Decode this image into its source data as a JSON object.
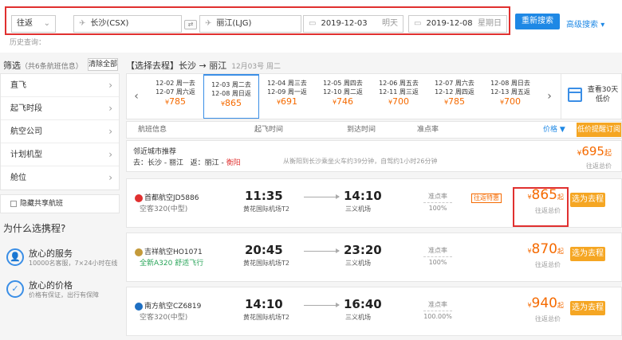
{
  "search": {
    "trip_type": "往返",
    "from_city": "长沙(CSX)",
    "to_city": "丽江(LJG)",
    "depart_date": "2019-12-03",
    "depart_weekday": "明天",
    "return_date": "2019-12-08",
    "return_weekday": "星期日",
    "swap_label": "⇄",
    "search_button": "重新搜索",
    "advanced_search": "高级搜索",
    "history_label": "历史查询："
  },
  "sidebar": {
    "filter_title": "筛选",
    "filter_count": "（共6条航班信息）",
    "clear_all": "清除全部",
    "items": [
      {
        "label": "直飞"
      },
      {
        "label": "起飞时段"
      },
      {
        "label": "航空公司"
      },
      {
        "label": "计划机型"
      },
      {
        "label": "舱位"
      }
    ],
    "shared_flights": "隐藏共享航班",
    "why_title": "为什么选携程?",
    "why_items": [
      {
        "title": "放心的服务",
        "desc": "10000名客服，7×24小时在线"
      },
      {
        "title": "放心的价格",
        "desc": "价格有保证，出行有保障"
      }
    ]
  },
  "main": {
    "route_title": "【选择去程】长沙 → 丽江",
    "route_date": "12月03号 周二",
    "dates": [
      {
        "go": "12-02 周一去",
        "back": "12-07 周六返",
        "price": "785"
      },
      {
        "go": "12-03 周二去",
        "back": "12-08 周日返",
        "price": "865"
      },
      {
        "go": "12-04 周三去",
        "back": "12-09 周一返",
        "price": "691"
      },
      {
        "go": "12-05 周四去",
        "back": "12-10 周二返",
        "price": "746"
      },
      {
        "go": "12-06 周五去",
        "back": "12-11 周三返",
        "price": "700"
      },
      {
        "go": "12-07 周六去",
        "back": "12-12 周四返",
        "price": "785"
      },
      {
        "go": "12-08 周日去",
        "back": "12-13 周五返",
        "price": "700"
      }
    ],
    "price_currency": "¥",
    "calendar_label": "查看30天低价",
    "columns": {
      "flight_info": "航班信息",
      "depart_time": "起飞时间",
      "arrive_time": "到达时间",
      "ontime_rate": "准点率",
      "price": "价格 ▼",
      "low_price_remind": "低价提醒订阅"
    },
    "nearby": {
      "title": "邻近城市推荐",
      "route_go": "去：长沙 - 丽江",
      "route_back_prefix": "返：丽江 - ",
      "route_back_city": "衡阳",
      "note": "从衡阳到长沙乘坐火车约39分钟，自驾约1小时26分钟",
      "price": "695",
      "price_suffix": "起",
      "price_label": "往返总价"
    },
    "flights": [
      {
        "airline": "首都航空JD5886",
        "plane_prefix": "空客320(中型)",
        "plane_green": "",
        "dep_time": "11:35",
        "dep_airport": "黄花国际机场T2",
        "arr_time": "14:10",
        "arr_airport": "三义机场",
        "ontime_label": "准点率",
        "ontime": "100%",
        "tag": "往返特惠",
        "price": "865",
        "price_suffix": "起",
        "price_label": "往返总价",
        "book": "选为去程",
        "logo_color": "#e0302f"
      },
      {
        "airline": "吉祥航空HO1071",
        "plane_prefix": "",
        "plane_green": "全新A320 舒适飞行",
        "dep_time": "20:45",
        "dep_airport": "黄花国际机场T2",
        "arr_time": "23:20",
        "arr_airport": "三义机场",
        "ontime_label": "准点率",
        "ontime": "100%",
        "tag": "",
        "price": "870",
        "price_suffix": "起",
        "price_label": "往返总价",
        "book": "选为去程",
        "logo_color": "#c49a3a"
      },
      {
        "airline": "南方航空CZ6819",
        "plane_prefix": "空客320(中型)",
        "plane_green": "",
        "dep_time": "14:10",
        "dep_airport": "黄花国际机场T2",
        "arr_time": "16:40",
        "arr_airport": "三义机场",
        "ontime_label": "准点率",
        "ontime": "100.00%",
        "tag": "",
        "price": "940",
        "price_suffix": "起",
        "price_label": "往返总价",
        "book": "选为去程",
        "logo_color": "#1e6fc2"
      }
    ]
  }
}
